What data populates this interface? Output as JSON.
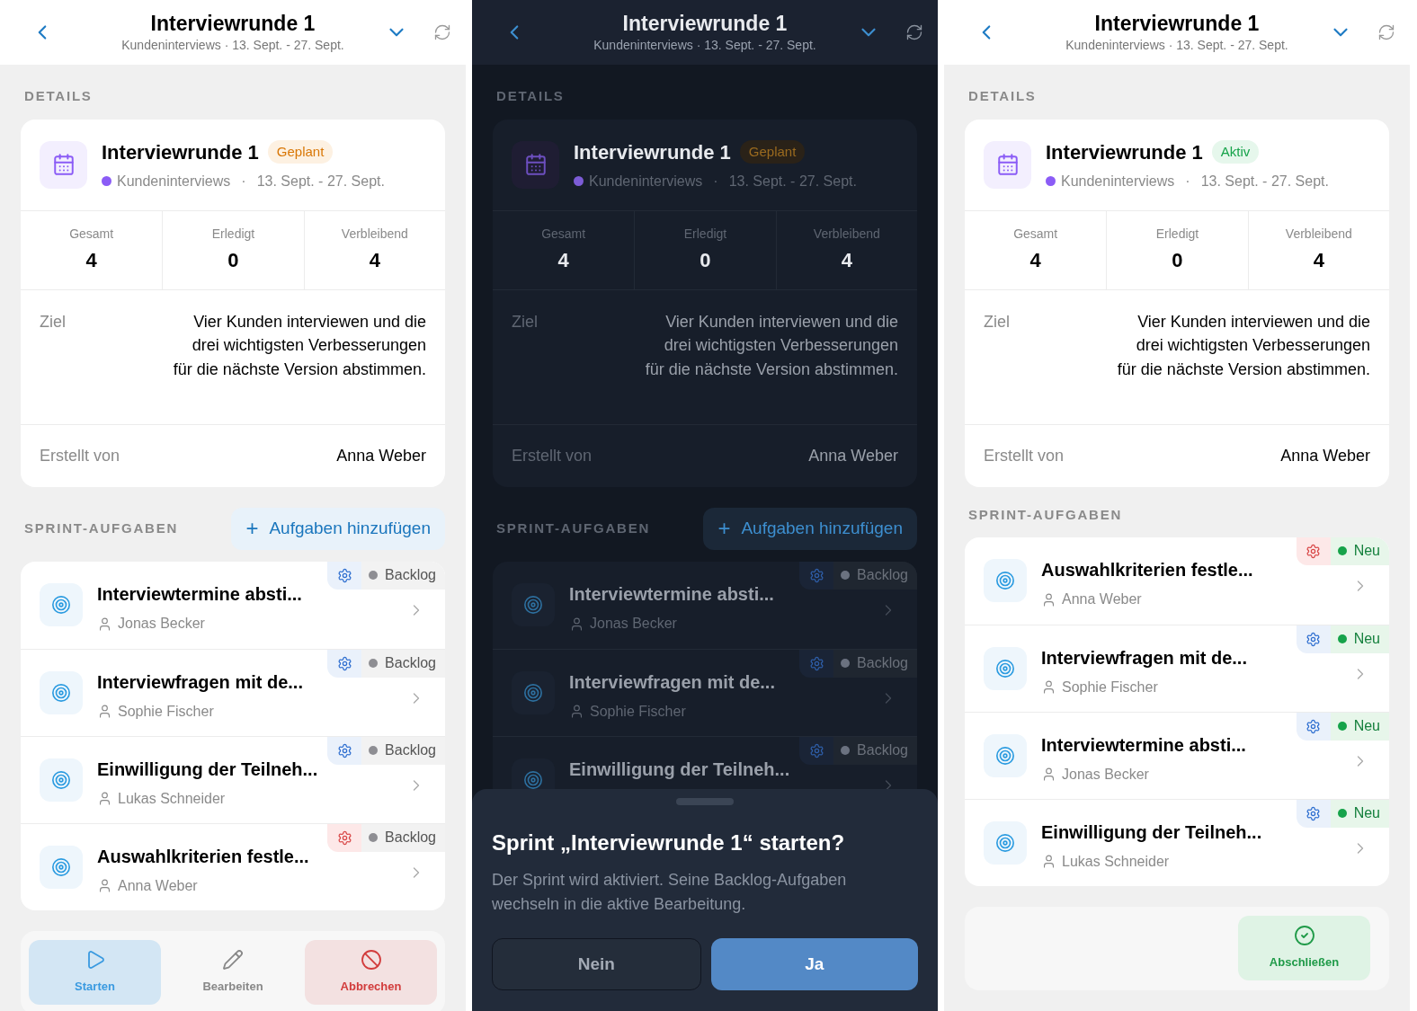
{
  "screens": [
    {
      "kind": "light",
      "header": {
        "title": "Interviewrunde 1",
        "subtitle": "Kundeninterviews · 13. Sept. - 27. Sept."
      },
      "details_heading": "DETAILS",
      "sprint": {
        "title": "Interviewrunde 1",
        "status": {
          "label": "Geplant",
          "kind": "planned"
        },
        "project": "Kundeninterviews",
        "color": "#8b5cf6",
        "separator": "·",
        "dates": "13. Sept. - 27. Sept."
      },
      "stats": [
        {
          "label": "Gesamt",
          "value": "4"
        },
        {
          "label": "Erledigt",
          "value": "0"
        },
        {
          "label": "Verbleibend",
          "value": "4"
        }
      ],
      "goal": {
        "label": "Ziel",
        "text": "Vier Kunden interviewen und die drei wichtigsten Verbesserungen für die nächste Version abstimmen."
      },
      "creator": {
        "label": "Erstellt von",
        "value": "Anna Weber"
      },
      "tasks_heading": "SPRINT-AUFGABEN",
      "add_button": {
        "icon": "+",
        "label": "Aufgaben hinzufügen"
      },
      "tasks": [
        {
          "title": "Interviewtermine absti...",
          "assignee": "Jonas Becker",
          "kind": "normal",
          "status": {
            "label": "Backlog",
            "color": "#8e8e93"
          }
        },
        {
          "title": "Interviewfragen mit de...",
          "assignee": "Sophie Fischer",
          "kind": "normal",
          "status": {
            "label": "Backlog",
            "color": "#8e8e93"
          }
        },
        {
          "title": "Einwilligung der Teilneh...",
          "assignee": "Lukas Schneider",
          "kind": "normal",
          "status": {
            "label": "Backlog",
            "color": "#8e8e93"
          }
        },
        {
          "title": "Auswahlkriterien festle...",
          "assignee": "Anna Weber",
          "kind": "high",
          "status": {
            "label": "Backlog",
            "color": "#8e8e93"
          }
        }
      ],
      "actions": [
        {
          "label": "Starten",
          "kind": "start"
        },
        {
          "label": "Bearbeiten",
          "kind": "edit"
        },
        {
          "label": "Abbrechen",
          "kind": "cancel"
        }
      ]
    },
    {
      "kind": "dark",
      "header": {
        "title": "Interviewrunde 1",
        "subtitle": "Kundeninterviews · 13. Sept. - 27. Sept."
      },
      "details_heading": "DETAILS",
      "sprint": {
        "title": "Interviewrunde 1",
        "status": {
          "label": "Geplant",
          "kind": "planned"
        },
        "project": "Kundeninterviews",
        "color": "#7c5cd6",
        "separator": "·",
        "dates": "13. Sept. - 27. Sept."
      },
      "stats": [
        {
          "label": "Gesamt",
          "value": "4"
        },
        {
          "label": "Erledigt",
          "value": "0"
        },
        {
          "label": "Verbleibend",
          "value": "4"
        }
      ],
      "goal": {
        "label": "Ziel",
        "text": "Vier Kunden interviewen und die drei wichtigsten Verbesserungen für die nächste Version abstimmen."
      },
      "creator": {
        "label": "Erstellt von",
        "value": "Anna Weber"
      },
      "tasks_heading": "SPRINT-AUFGABEN",
      "add_button": {
        "icon": "+",
        "label": "Aufgaben hinzufügen"
      },
      "tasks": [
        {
          "title": "Interviewtermine absti...",
          "assignee": "Jonas Becker",
          "kind": "normal",
          "status": {
            "label": "Backlog",
            "color": "#6b7280"
          }
        },
        {
          "title": "Interviewfragen mit de...",
          "assignee": "Sophie Fischer",
          "kind": "normal",
          "status": {
            "label": "Backlog",
            "color": "#6b7280"
          }
        },
        {
          "title": "Einwilligung der Teilneh...",
          "kind": "normal",
          "status": {
            "label": "Backlog",
            "color": "#6b7280"
          }
        }
      ],
      "dialog": {
        "title": "Sprint „Interviewrunde 1“ starten?",
        "text": "Der Sprint wird aktiviert. Seine Backlog-Aufgaben wechseln in die aktive Bearbeitung.",
        "buttons": [
          {
            "label": "Nein",
            "kind": "secondary"
          },
          {
            "label": "Ja",
            "kind": "primary"
          }
        ]
      }
    },
    {
      "kind": "light",
      "header": {
        "title": "Interviewrunde 1",
        "subtitle": "Kundeninterviews · 13. Sept. - 27. Sept."
      },
      "details_heading": "DETAILS",
      "sprint": {
        "title": "Interviewrunde 1",
        "status": {
          "label": "Aktiv",
          "kind": "active"
        },
        "project": "Kundeninterviews",
        "color": "#8b5cf6",
        "separator": "·",
        "dates": "13. Sept. - 27. Sept."
      },
      "stats": [
        {
          "label": "Gesamt",
          "value": "4"
        },
        {
          "label": "Erledigt",
          "value": "0"
        },
        {
          "label": "Verbleibend",
          "value": "4"
        }
      ],
      "goal": {
        "label": "Ziel",
        "text": "Vier Kunden interviewen und die drei wichtigsten Verbesserungen für die nächste Version abstimmen."
      },
      "creator": {
        "label": "Erstellt von",
        "value": "Anna Weber"
      },
      "tasks_heading": "SPRINT-AUFGABEN",
      "tasks": [
        {
          "title": "Auswahlkriterien festle...",
          "assignee": "Anna Weber",
          "kind": "high",
          "status": {
            "label": "Neu",
            "color": "#16a34a"
          }
        },
        {
          "title": "Interviewfragen mit de...",
          "assignee": "Sophie Fischer",
          "kind": "normal",
          "status": {
            "label": "Neu",
            "color": "#16a34a"
          }
        },
        {
          "title": "Interviewtermine absti...",
          "assignee": "Jonas Becker",
          "kind": "normal",
          "status": {
            "label": "Neu",
            "color": "#16a34a"
          }
        },
        {
          "title": "Einwilligung der Teilneh...",
          "assignee": "Lukas Schneider",
          "kind": "normal",
          "status": {
            "label": "Neu",
            "color": "#16a34a"
          }
        }
      ],
      "actions": [
        {
          "label": "Abschließen",
          "kind": "complete"
        }
      ]
    }
  ]
}
